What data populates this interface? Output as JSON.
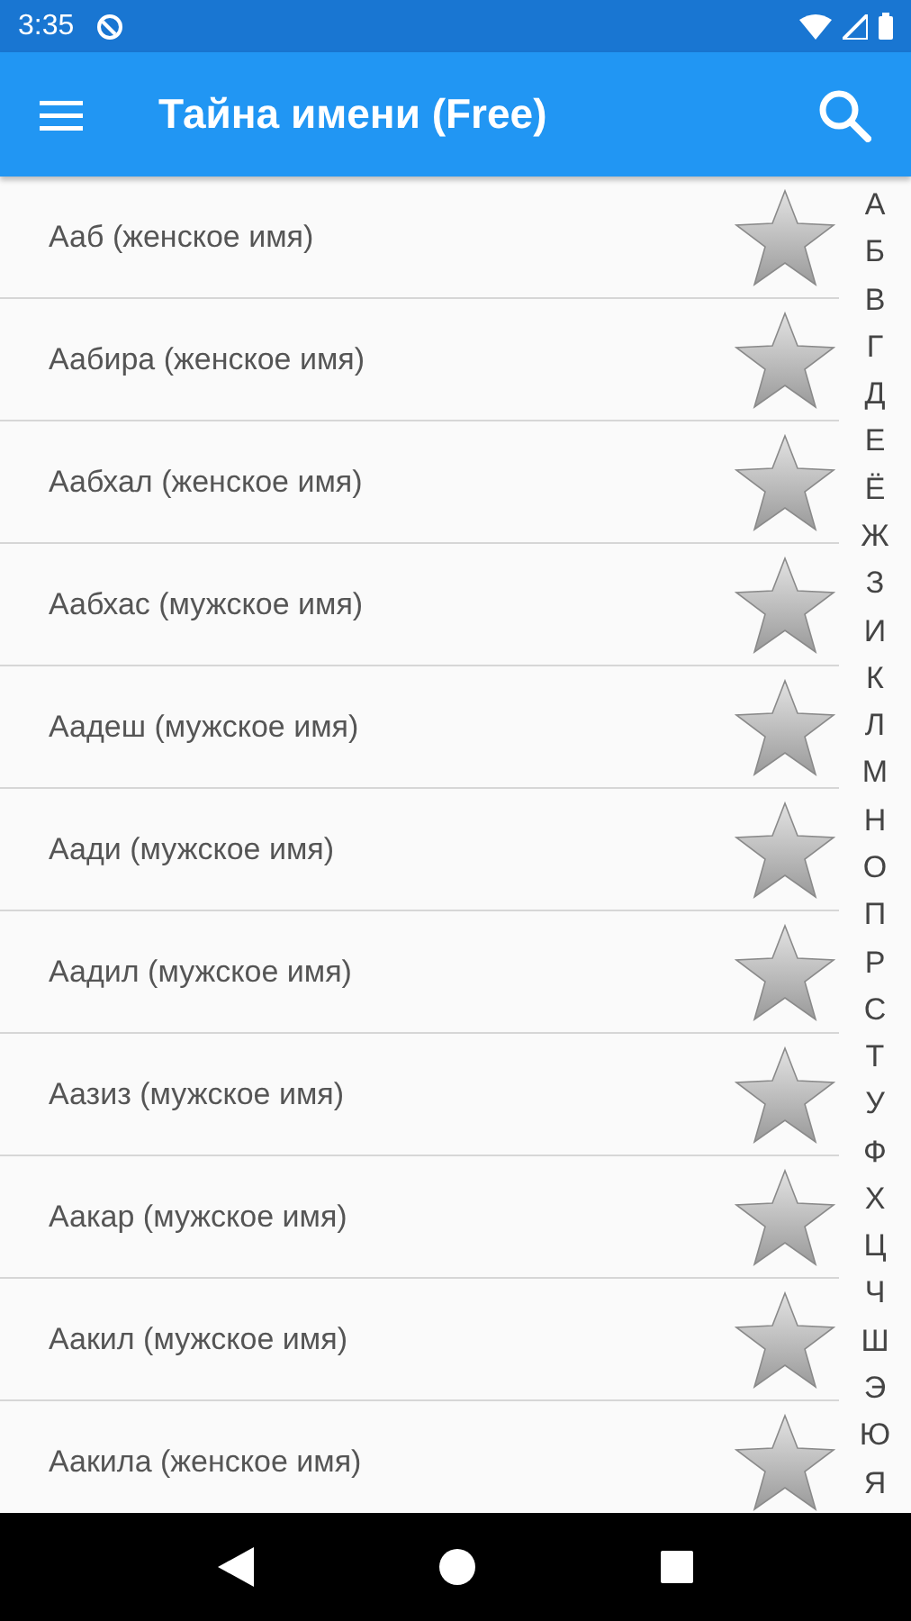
{
  "status_bar": {
    "time": "3:35"
  },
  "app_bar": {
    "title": "Тайна имени (Free)"
  },
  "names": [
    {
      "label": "Ааб (женское имя)",
      "favorite": false
    },
    {
      "label": "Аабира (женское имя)",
      "favorite": false
    },
    {
      "label": "Аабхал (женское имя)",
      "favorite": false
    },
    {
      "label": "Аабхас (мужское имя)",
      "favorite": false
    },
    {
      "label": "Аадеш (мужское имя)",
      "favorite": false
    },
    {
      "label": "Аади (мужское имя)",
      "favorite": false
    },
    {
      "label": "Аадил (мужское имя)",
      "favorite": false
    },
    {
      "label": "Аазиз (мужское имя)",
      "favorite": false
    },
    {
      "label": "Аакар (мужское имя)",
      "favorite": false
    },
    {
      "label": "Аакил (мужское имя)",
      "favorite": false
    },
    {
      "label": "Аакила (женское имя)",
      "favorite": false
    }
  ],
  "alphabet": [
    "А",
    "Б",
    "В",
    "Г",
    "Д",
    "Е",
    "Ё",
    "Ж",
    "З",
    "И",
    "К",
    "Л",
    "М",
    "Н",
    "О",
    "П",
    "Р",
    "С",
    "Т",
    "У",
    "Ф",
    "Х",
    "Ц",
    "Ч",
    "Ш",
    "Э",
    "Ю",
    "Я"
  ]
}
